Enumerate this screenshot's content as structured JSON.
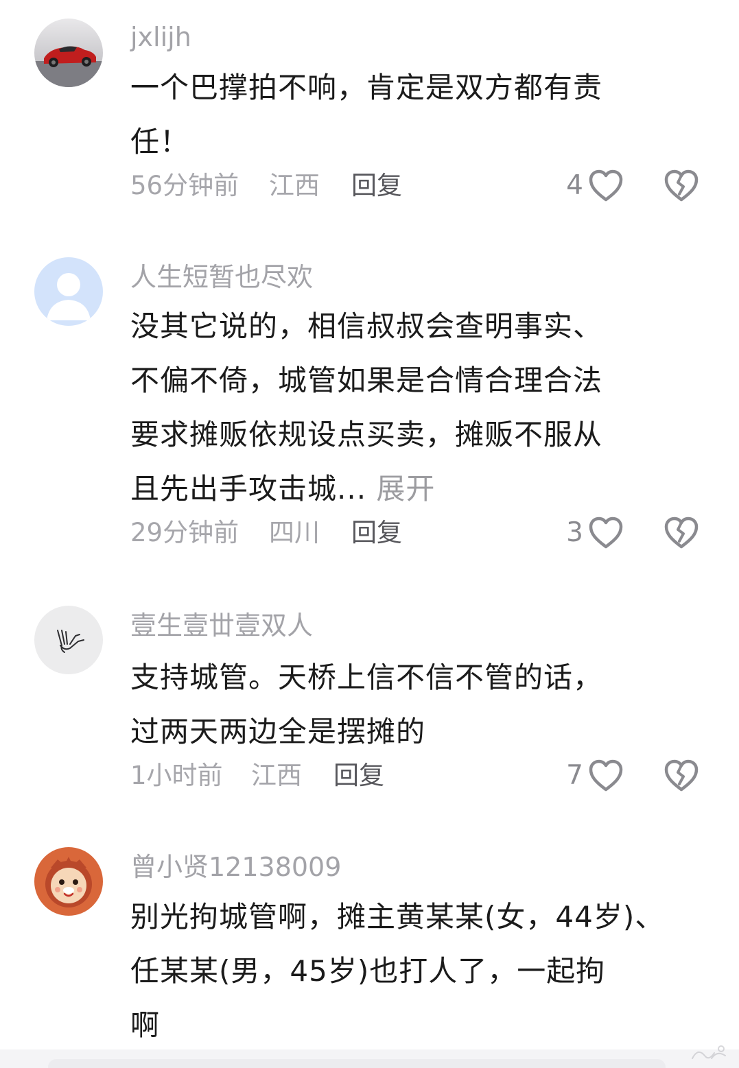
{
  "colors": {
    "username": "#a3a3a8",
    "content": "#1b1b1b",
    "meta": "#a6a6ab",
    "reply": "#57575c",
    "icon_outline": "#8a8a8f"
  },
  "comments": [
    {
      "username": "jxlijh",
      "avatar": "red-sports-car-avatar",
      "lines": [
        "一个巴撑拍不响，肯定是双方都有责",
        "任！"
      ],
      "time": "56分钟前",
      "location": "江西",
      "reply": "回复",
      "likes": "4"
    },
    {
      "username": "人生短暂也尽欢",
      "avatar": "default-user-avatar",
      "lines": [
        "没其它说的，相信叔叔会查明事实、",
        "不偏不倚，城管如果是合情合理合法",
        "要求摊贩依规设点买卖，摊贩不服从",
        "且先出手攻击城..."
      ],
      "expand": " 展开",
      "time": "29分钟前",
      "location": "四川",
      "reply": "回复",
      "likes": "3"
    },
    {
      "username": "壹生壹丗壹双人",
      "avatar": "hand-gesture-avatar",
      "lines": [
        "支持城管。天桥上信不信不管的话，",
        "过两天两边全是摆摊的"
      ],
      "time": "1小时前",
      "location": "江西",
      "reply": "回复",
      "likes": "7"
    },
    {
      "username": "曾小贤12138009",
      "avatar": "cartoon-lion-avatar",
      "lines": [
        "别光拘城管啊，摊主黄某某(女，44岁)、",
        "任某某(男，45岁)也打人了，一起拘",
        "啊"
      ]
    }
  ],
  "icons": {
    "like": "heart-outline-icon",
    "dislike": "broken-heart-icon"
  }
}
